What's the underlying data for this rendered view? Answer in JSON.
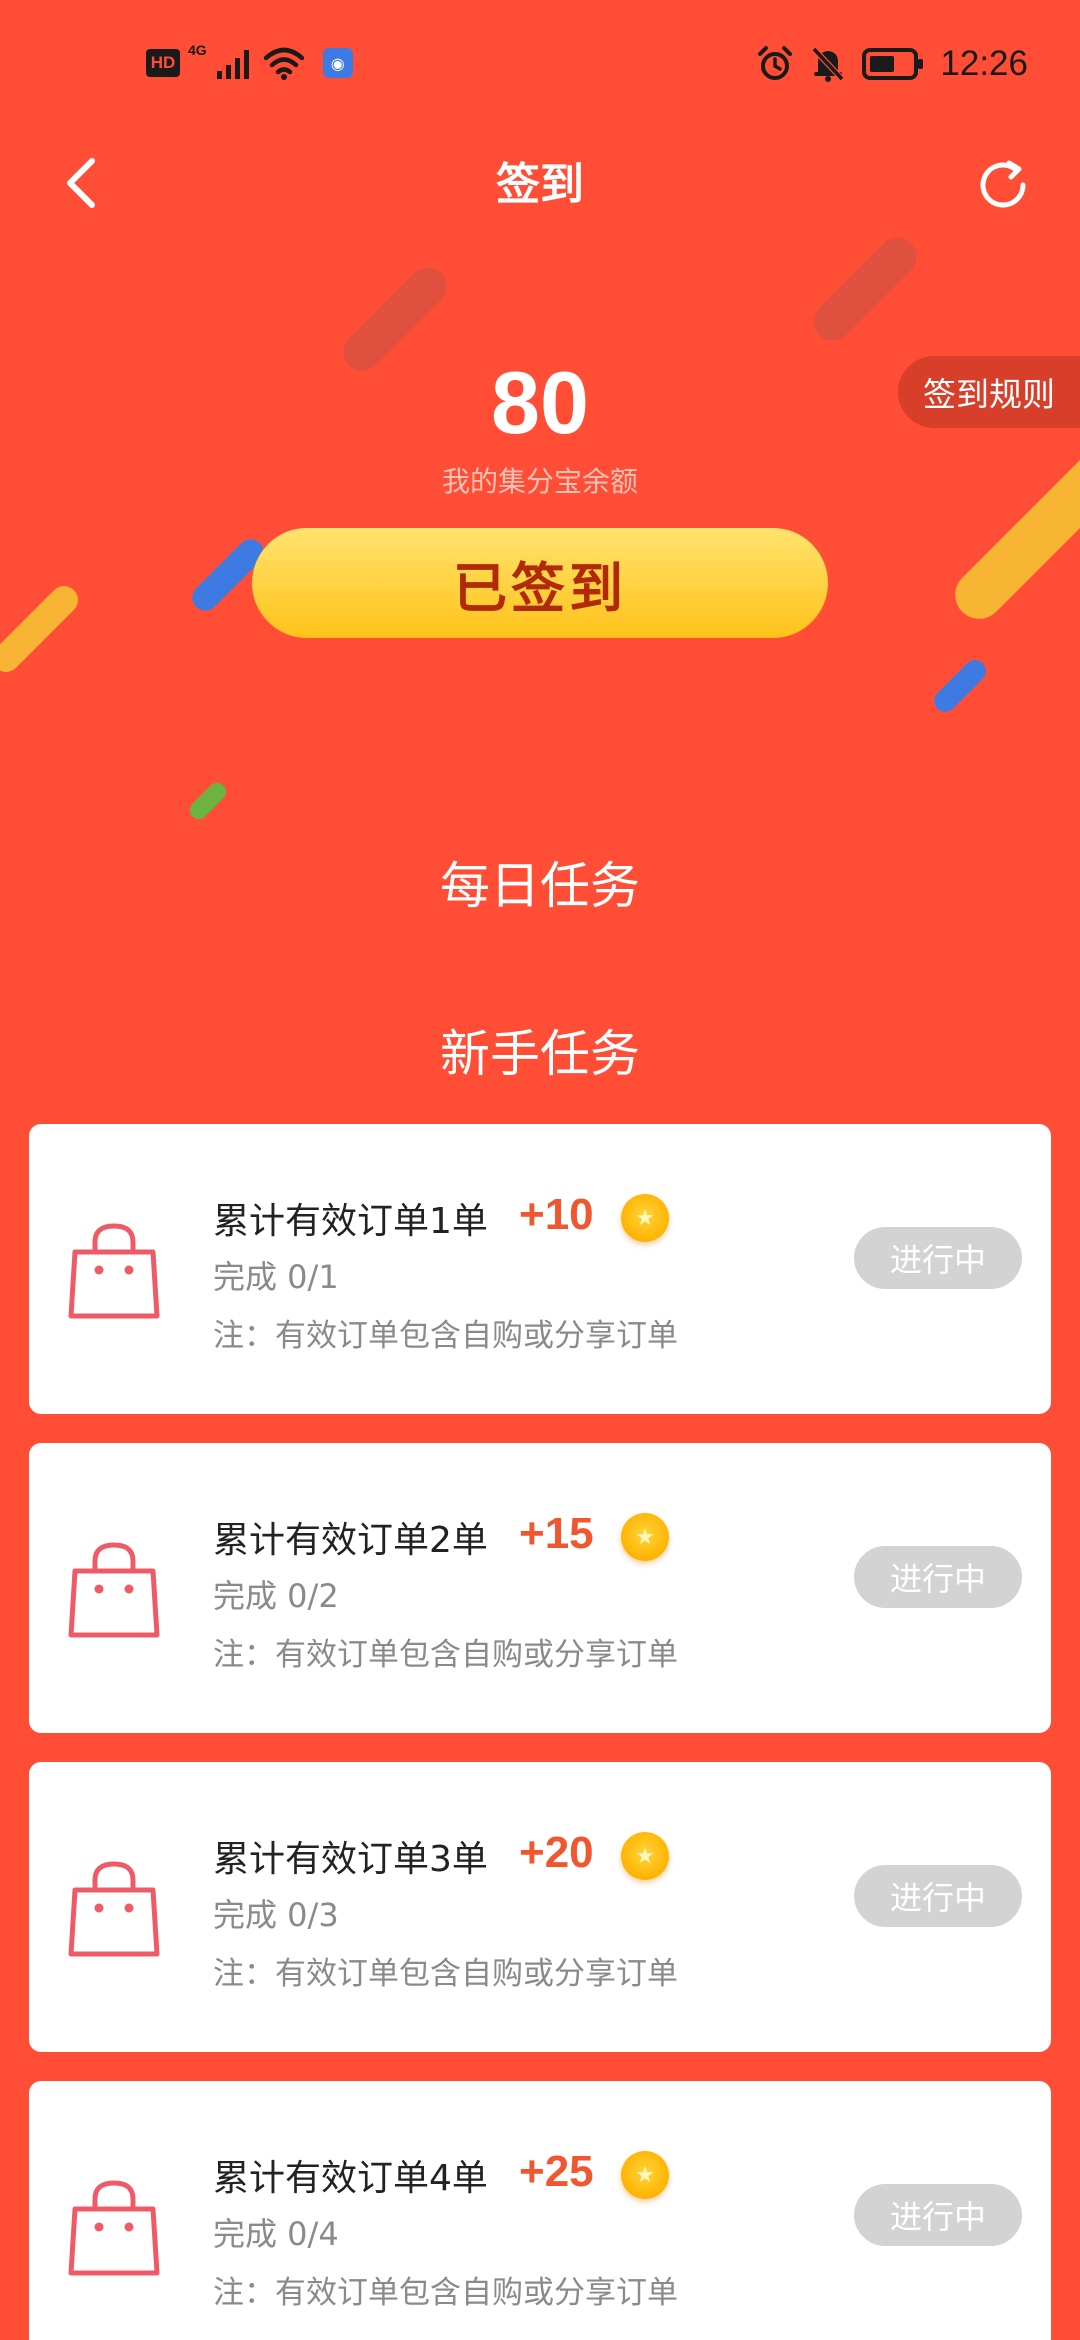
{
  "status_bar": {
    "network_badge": "HD",
    "network_type": "4G",
    "time": "12:26"
  },
  "header": {
    "title": "签到"
  },
  "balance": {
    "value": "80",
    "label": "我的集分宝余额"
  },
  "rules_button": "签到规则",
  "signin_button": "已签到",
  "sections": {
    "daily": "每日任务",
    "newbie": "新手任务"
  },
  "tasks": [
    {
      "name": "累计有效订单1单",
      "points": "+10",
      "progress": "完成 0/1",
      "note": "注：有效订单包含自购或分享订单",
      "status": "进行中"
    },
    {
      "name": "累计有效订单2单",
      "points": "+15",
      "progress": "完成 0/2",
      "note": "注：有效订单包含自购或分享订单",
      "status": "进行中"
    },
    {
      "name": "累计有效订单3单",
      "points": "+20",
      "progress": "完成 0/3",
      "note": "注：有效订单包含自购或分享订单",
      "status": "进行中"
    },
    {
      "name": "累计有效订单4单",
      "points": "+25",
      "progress": "完成 0/4",
      "note": "注：有效订单包含自购或分享订单",
      "status": "进行中"
    }
  ],
  "colors": {
    "background": "#FF4D36",
    "signin_button": "#FFC219",
    "points": "#F1572F",
    "status_pill": "#D3D3D3"
  }
}
